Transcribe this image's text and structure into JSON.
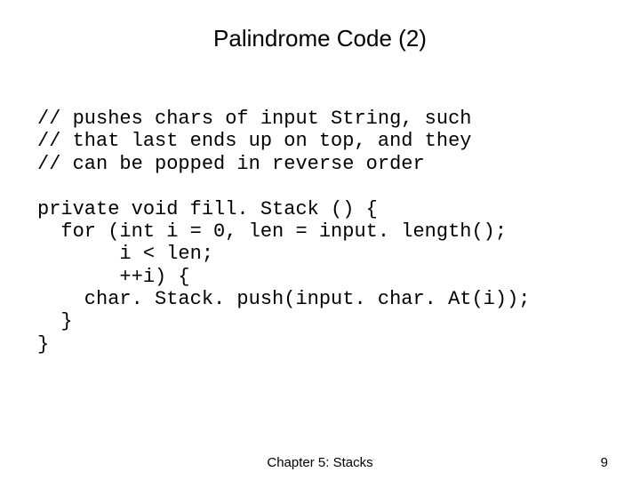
{
  "title": "Palindrome Code (2)",
  "comments": {
    "line1": "// pushes chars of input String, such",
    "line2": "// that last ends up on top, and they",
    "line3": "// can be popped in reverse order"
  },
  "code": {
    "line1": "private void fill. Stack () {",
    "line2": "  for (int i = 0, len = input. length();",
    "line3": "       i < len;",
    "line4": "       ++i) {",
    "line5": "    char. Stack. push(input. char. At(i));",
    "line6": "  }",
    "line7": "}"
  },
  "footer": {
    "chapter": "Chapter 5: Stacks",
    "page": "9"
  }
}
